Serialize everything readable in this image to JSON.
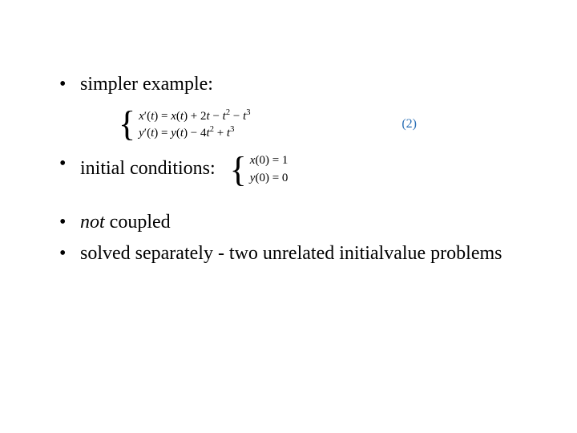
{
  "bullets": {
    "b1": "simpler  example:",
    "b2": "initial conditions:",
    "b3_prefix_italic": "not",
    "b3_rest": " coupled",
    "b4": "solved separately - two unrelated initialvalue problems"
  },
  "system": {
    "eq1": "x′(t) = x(t) + 2t − t² − t³",
    "eq2": "y′(t) = y(t) − 4t² + t³",
    "label": "(2)"
  },
  "ic": {
    "eq1": "x(0) = 1",
    "eq2": "y(0) = 0"
  }
}
